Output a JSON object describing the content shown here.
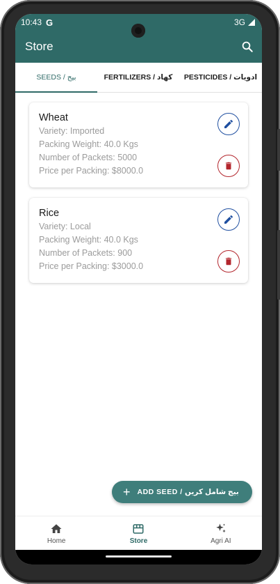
{
  "status_bar": {
    "time": "10:43",
    "network": "3G",
    "google_badge": "G"
  },
  "app_bar": {
    "title": "Store",
    "search_icon": "search-icon"
  },
  "tabs": [
    {
      "label": "SEEDS / بیج",
      "active": true
    },
    {
      "label": "FERTILIZERS / کھاد",
      "active": false
    },
    {
      "label": "PESTICIDES / ادویات",
      "active": false
    }
  ],
  "items": [
    {
      "name": "Wheat",
      "variety": "Variety: Imported",
      "packing_weight": "Packing Weight: 40.0 Kgs",
      "packets": "Number of Packets: 5000",
      "price": "Price per Packing: $8000.0"
    },
    {
      "name": "Rice",
      "variety": "Variety: Local",
      "packing_weight": "Packing Weight: 40.0 Kgs",
      "packets": "Number of Packets: 900",
      "price": "Price per Packing: $3000.0"
    }
  ],
  "fab": {
    "plus": "+",
    "label": "ADD SEED / بیج شامل کریں"
  },
  "bottom_nav": [
    {
      "label": "Home",
      "icon": "home-icon",
      "active": false
    },
    {
      "label": "Store",
      "icon": "store-icon",
      "active": true
    },
    {
      "label": "Agri AI",
      "icon": "sparkle-icon",
      "active": false
    }
  ],
  "colors": {
    "primary": "#2f6a67",
    "fab": "#3f7e7b",
    "edit": "#1f4fa0",
    "delete": "#b3262d"
  }
}
